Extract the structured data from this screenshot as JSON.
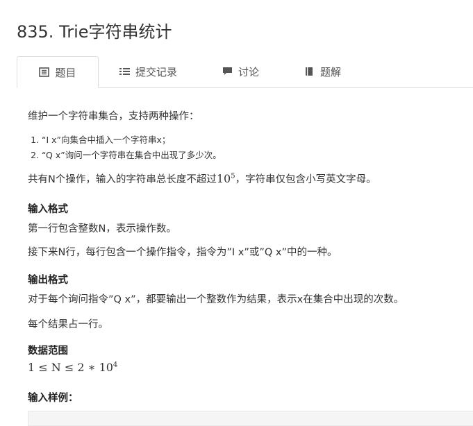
{
  "title": "835. Trie字符串统计",
  "tabs": [
    {
      "label": "题目",
      "icon": "document-list-icon"
    },
    {
      "label": "提交记录",
      "icon": "bulleted-list-icon"
    },
    {
      "label": "讨论",
      "icon": "comment-icon"
    },
    {
      "label": "题解",
      "icon": "book-icon"
    }
  ],
  "problem": {
    "intro": "维护一个字符串集合，支持两种操作：",
    "ops": [
      {
        "num": "1.",
        "text": "“I x”向集合中插入一个字符串x；"
      },
      {
        "num": "2.",
        "text": "“Q x”询问一个字符串在集合中出现了多少次。"
      }
    ],
    "limit_prefix": "共有N个操作，输入的字符串总长度不超过 ",
    "limit_math_base": "10",
    "limit_math_exp": "5",
    "limit_suffix": "，字符串仅包含小写英文字母。"
  },
  "input_format": {
    "heading": "输入格式",
    "line1": "第一行包含整数N，表示操作数。",
    "line2": "接下来N行，每行包含一个操作指令，指令为”I x”或”Q x”中的一种。"
  },
  "output_format": {
    "heading": "输出格式",
    "line1": "对于每个询问指令”Q x”，都要输出一个整数作为结果，表示x在集合中出现的次数。",
    "line2": "每个结果占一行。"
  },
  "data_range": {
    "heading": "数据范围",
    "formula_prefix": "1 ≤ N ≤ 2 ∗ 10",
    "formula_exp": "4"
  },
  "sample": {
    "heading": "输入样例："
  }
}
